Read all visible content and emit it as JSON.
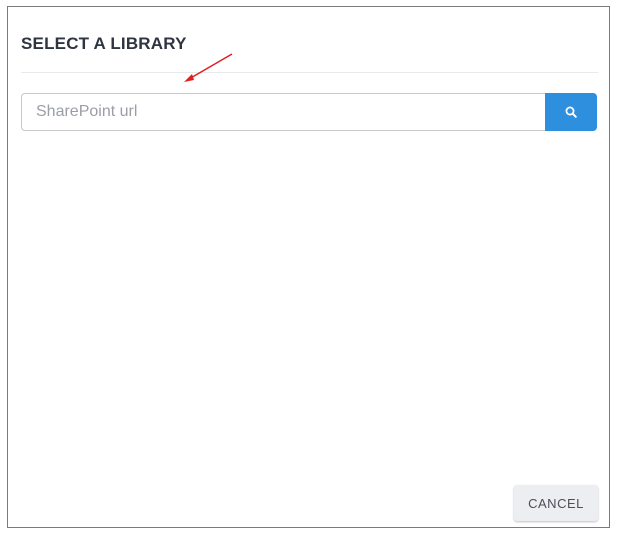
{
  "dialog": {
    "title": "SELECT A LIBRARY"
  },
  "search": {
    "placeholder": "SharePoint url",
    "value": "",
    "button_icon": "search-icon",
    "button_color": "#2d8fdd"
  },
  "footer": {
    "cancel_label": "CANCEL"
  },
  "annotation": {
    "color": "#e02020"
  }
}
